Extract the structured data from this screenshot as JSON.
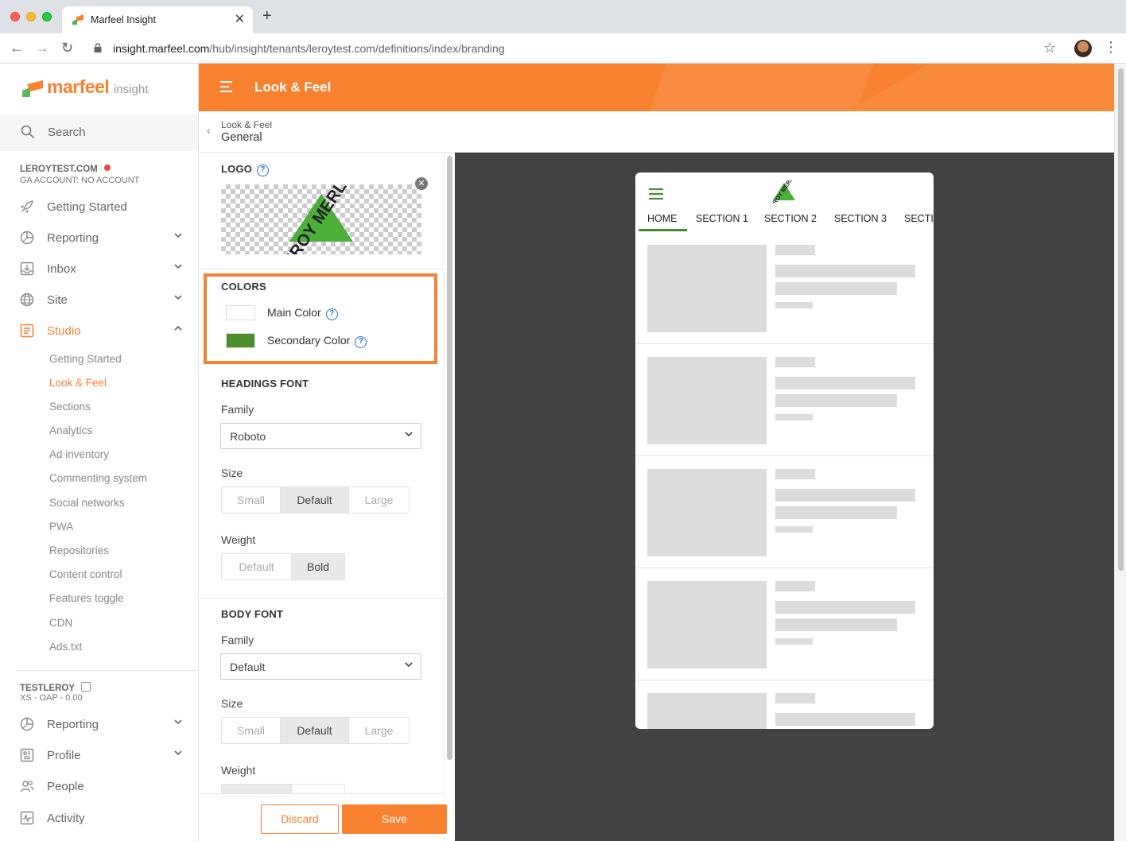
{
  "browser": {
    "tab_title": "Marfeel Insight",
    "url_host": "insight.marfeel.com",
    "url_path": "/hub/insight/tenants/leroytest.com/definitions/index/branding",
    "tab_close": "✕",
    "new_tab": "+"
  },
  "sidebar": {
    "brand_name": "marfeel",
    "brand_sub": "insight",
    "search_placeholder": "Search",
    "account1": {
      "name": "LEROYTEST.COM",
      "sub": "GA ACCOUNT: NO ACCOUNT"
    },
    "nav1": [
      {
        "label": "Getting Started",
        "icon": "rocket-icon"
      },
      {
        "label": "Reporting",
        "icon": "pie-chart-icon"
      },
      {
        "label": "Inbox",
        "icon": "inbox-icon"
      },
      {
        "label": "Site",
        "icon": "globe-icon"
      },
      {
        "label": "Studio",
        "icon": "studio-icon"
      }
    ],
    "studio_items": [
      "Getting Started",
      "Look & Feel",
      "Sections",
      "Analytics",
      "Ad inventory",
      "Commenting system",
      "Social networks",
      "PWA",
      "Repositories",
      "Content control",
      "Features toggle",
      "CDN",
      "Ads.txt"
    ],
    "account2": {
      "name": "TESTLEROY",
      "sub": "XS - OAP - 0.00"
    },
    "nav2": [
      {
        "label": "Reporting",
        "icon": "pie-chart-icon"
      },
      {
        "label": "Profile",
        "icon": "profile-icon"
      },
      {
        "label": "People",
        "icon": "people-icon"
      },
      {
        "label": "Activity",
        "icon": "activity-icon"
      }
    ]
  },
  "header": {
    "title": "Look & Feel"
  },
  "breadcrumb": {
    "parent": "Look & Feel",
    "current": "General"
  },
  "panel": {
    "logo_title": "LOGO",
    "logo_text": "LEROY MERLIN",
    "colors_title": "COLORS",
    "main_color_label": "Main Color",
    "secondary_color_label": "Secondary Color",
    "main_color": "#ffffff",
    "secondary_color": "#4d8f2a",
    "help_glyph": "?",
    "headings_font": {
      "title": "HEADINGS FONT",
      "family_label": "Family",
      "family_value": "Roboto",
      "size_label": "Size",
      "size_options": [
        "Small",
        "Default",
        "Large"
      ],
      "size_selected": "Default",
      "weight_label": "Weight",
      "weight_options": [
        "Default",
        "Bold"
      ],
      "weight_selected": "Bold"
    },
    "body_font": {
      "title": "BODY FONT",
      "family_label": "Family",
      "family_value": "Default",
      "size_label": "Size",
      "size_options": [
        "Small",
        "Default",
        "Large"
      ],
      "size_selected": "Default",
      "weight_label": "Weight"
    },
    "discard_label": "Discard",
    "save_label": "Save"
  },
  "preview": {
    "tabs": [
      "HOME",
      "SECTION 1",
      "SECTION 2",
      "SECTION 3",
      "SECTI"
    ],
    "active_tab": "HOME",
    "accent": "#3a8f2a"
  },
  "colors": {
    "brand": "#f7812f",
    "preview_bg": "#424242"
  }
}
